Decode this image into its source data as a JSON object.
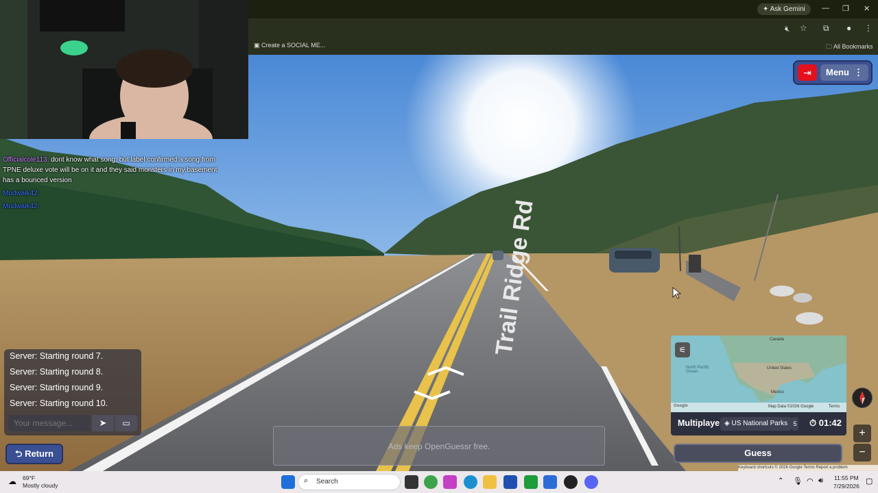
{
  "browser": {
    "ask_gemini": "Ask Gemini",
    "bookmark_1": "Create a SOCIAL ME...",
    "all_bookmarks": "All Bookmarks"
  },
  "stream_chat": {
    "messages": [
      {
        "user": "Officialcole113:",
        "text": "dont know what song, but label confirmed a song from TPNE deluxe vote will be on it and they said monsters in my basement has a bounced version"
      },
      {
        "user": "Mudwalk42:",
        "text": ""
      },
      {
        "user": "Mudwalk42:",
        "text": ""
      }
    ]
  },
  "scene": {
    "road_sign_text": "Trail Ridge Rd"
  },
  "game": {
    "menu_label": "Menu",
    "chat": {
      "messages": [
        "Server: Starting round 7.",
        "Server: Starting round 8.",
        "Server: Starting round 9.",
        "Server: Starting round 10."
      ],
      "input_placeholder": "Your message..."
    },
    "return_label": "Return",
    "ad_text": "Ads keep OpenGuessr free.",
    "minimap": {
      "labels": [
        "Canada",
        "United States",
        "Mexico",
        "North Pacific Ocean"
      ],
      "footer_left": "Google",
      "map_data": "Map Data ©2026 Google",
      "terms": "Terms"
    },
    "mode": "Multiplayer",
    "map_name": "US National Parks",
    "round_glyph": "5",
    "timer": "01:42",
    "guess_label": "Guess",
    "zoom_in": "+",
    "zoom_out": "−",
    "google_footer": "Keyboard shortcuts  © 2026 Google  Terms  Report a problem"
  },
  "taskbar": {
    "temp": "69°F",
    "condition": "Mostly cloudy",
    "search_label": "Search",
    "time": "11:55 PM",
    "date": "7/29/2026"
  }
}
